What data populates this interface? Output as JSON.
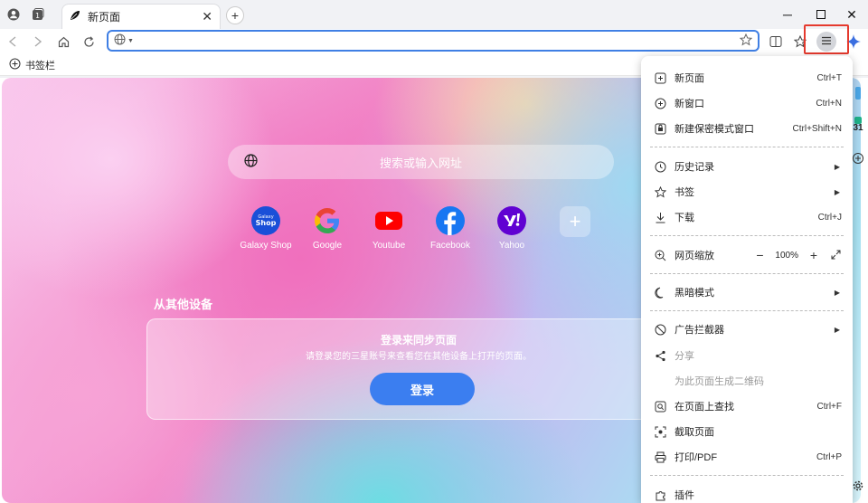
{
  "tab": {
    "title": "新页面"
  },
  "omnibox": {
    "value": "",
    "placeholder": ""
  },
  "bookmarks_bar": {
    "label": "书签栏"
  },
  "newtab": {
    "search_placeholder": "搜索或输入网址",
    "shortcuts": [
      {
        "label": "Galaxy Shop",
        "icon": "galaxy-shop-icon",
        "color": "#1a4fd8"
      },
      {
        "label": "Google",
        "icon": "google-icon",
        "color": "#ffffff"
      },
      {
        "label": "Youtube",
        "icon": "youtube-icon",
        "color": "#ffffff"
      },
      {
        "label": "Facebook",
        "icon": "facebook-icon",
        "color": "#1877f2"
      },
      {
        "label": "Yahoo",
        "icon": "yahoo-icon",
        "color": "#6001d2"
      }
    ],
    "galaxy_shop_logo_text": "Galaxy",
    "galaxy_shop_logo_text2": "Shop",
    "other_devices_title": "从其他设备",
    "sync_title": "登录来同步页面",
    "sync_desc": "请登录您的三星账号来查看您在其他设备上打开的页面。",
    "login_button": "登录"
  },
  "peek": {
    "calendar_day": "31"
  },
  "menu": {
    "new_tab": {
      "label": "新页面",
      "shortcut": "Ctrl+T"
    },
    "new_window": {
      "label": "新窗口",
      "shortcut": "Ctrl+N"
    },
    "new_secret": {
      "label": "新建保密模式窗口",
      "shortcut": "Ctrl+Shift+N"
    },
    "history": {
      "label": "历史记录"
    },
    "bookmarks": {
      "label": "书签"
    },
    "downloads": {
      "label": "下载",
      "shortcut": "Ctrl+J"
    },
    "zoom": {
      "label": "网页缩放",
      "value": "100%"
    },
    "dark_mode": {
      "label": "黑暗模式"
    },
    "ad_blocker": {
      "label": "广告拦截器"
    },
    "share": {
      "label": "分享"
    },
    "qr_code": {
      "label": "为此页面生成二维码"
    },
    "find": {
      "label": "在页面上查找",
      "shortcut": "Ctrl+F"
    },
    "capture": {
      "label": "截取页面"
    },
    "print": {
      "label": "打印/PDF",
      "shortcut": "Ctrl+P"
    },
    "addons": {
      "label": "插件"
    }
  },
  "colors": {
    "accent": "#3f7fe4",
    "highlight": "#e53a2e",
    "login": "#3b7ef0"
  }
}
